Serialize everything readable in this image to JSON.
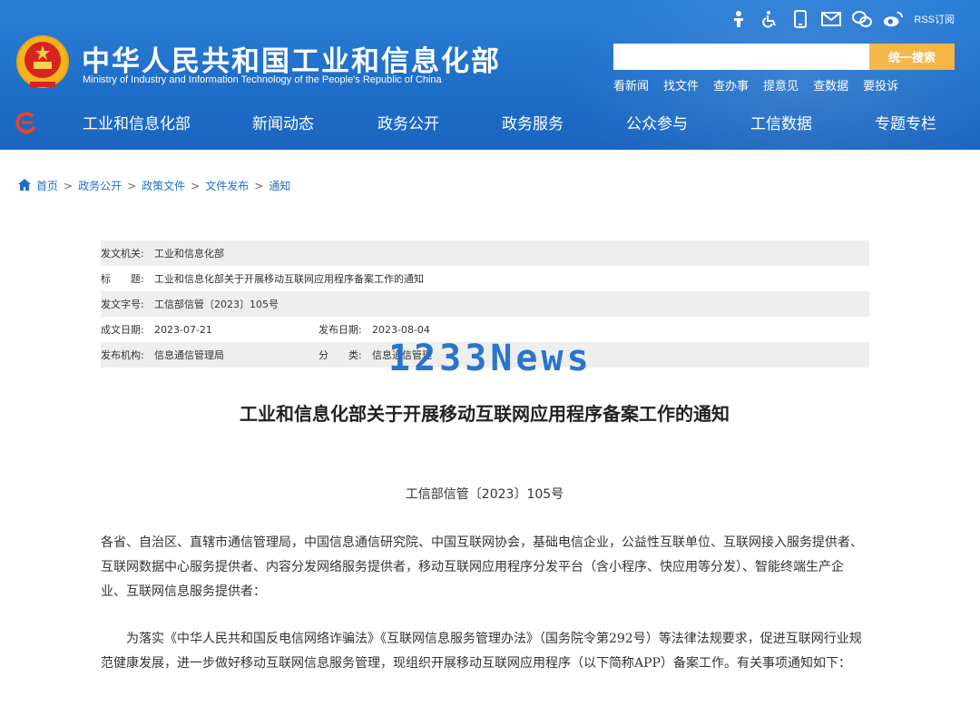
{
  "header": {
    "title": "中华人民共和国工业和信息化部",
    "subtitle": "Ministry of Industry and Information Technology of the People's Republic of China",
    "toolbar": {
      "icons": [
        "elderly-icon",
        "accessibility-icon",
        "mobile-icon",
        "mail-icon",
        "wechat-icon",
        "weibo-icon"
      ],
      "rss_label": "RSS订阅"
    },
    "search": {
      "placeholder": "",
      "button_label": "统一搜索"
    },
    "quick_links": [
      "看新闻",
      "找文件",
      "查办事",
      "提意见",
      "查数据",
      "要投诉"
    ]
  },
  "nav": {
    "items": [
      "工业和信息化部",
      "新闻动态",
      "政务公开",
      "政务服务",
      "公众参与",
      "工信数据",
      "专题专栏"
    ]
  },
  "breadcrumb": [
    "首页",
    "政务公开",
    "政策文件",
    "文件发布",
    "通知"
  ],
  "info": {
    "issuer_label": "发文机关:",
    "issuer": "工业和信息化部",
    "title_label": "标　　题:",
    "title": "工业和信息化部关于开展移动互联网应用程序备案工作的通知",
    "doc_no_label": "发文字号:",
    "doc_no": "工信部信管〔2023〕105号",
    "created_label": "成文日期:",
    "created": "2023-07-21",
    "published_label": "发布日期:",
    "published": "2023-08-04",
    "org_label": "发布机构:",
    "org": "信息通信管理局",
    "category_label": "分　　类:",
    "category": "信息通信管理"
  },
  "watermark": "1233News",
  "document": {
    "title": "工业和信息化部关于开展移动互联网应用程序备案工作的通知",
    "number": "工信部信管〔2023〕105号",
    "paragraph1": "各省、自治区、直辖市通信管理局，中国信息通信研究院、中国互联网协会，基础电信企业，公益性互联单位、互联网接入服务提供者、互联网数据中心服务提供者、内容分发网络服务提供者，移动互联网应用程序分发平台（含小程序、快应用等分发）、智能终端生产企业、互联网信息服务提供者：",
    "paragraph2": "为落实《中华人民共和国反电信网络诈骗法》《互联网信息服务管理办法》（国务院令第292号）等法律法规要求，促进互联网行业规范健康发展，进一步做好移动互联网信息服务管理，现组织开展移动互联网应用程序（以下简称APP）备案工作。有关事项通知如下："
  },
  "colors": {
    "header_blue": "#1f6fc9",
    "search_button": "#f4b23b",
    "link": "#1f6fc9"
  }
}
